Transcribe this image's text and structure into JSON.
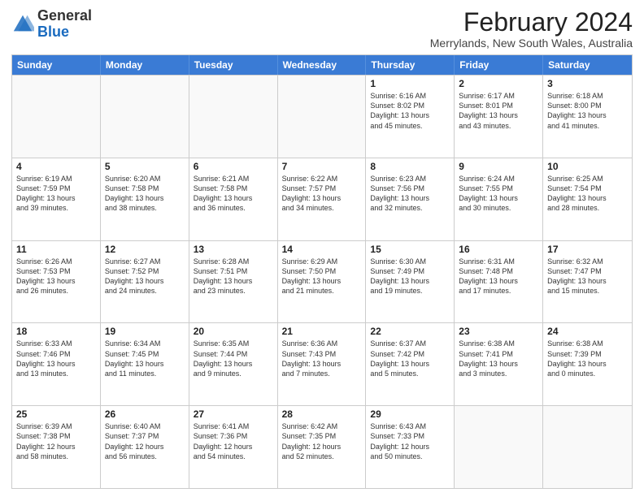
{
  "header": {
    "logo": {
      "general": "General",
      "blue": "Blue"
    },
    "title": "February 2024",
    "location": "Merrylands, New South Wales, Australia"
  },
  "calendar": {
    "days_of_week": [
      "Sunday",
      "Monday",
      "Tuesday",
      "Wednesday",
      "Thursday",
      "Friday",
      "Saturday"
    ],
    "weeks": [
      [
        {
          "day": "",
          "info": ""
        },
        {
          "day": "",
          "info": ""
        },
        {
          "day": "",
          "info": ""
        },
        {
          "day": "",
          "info": ""
        },
        {
          "day": "1",
          "info": "Sunrise: 6:16 AM\nSunset: 8:02 PM\nDaylight: 13 hours\nand 45 minutes."
        },
        {
          "day": "2",
          "info": "Sunrise: 6:17 AM\nSunset: 8:01 PM\nDaylight: 13 hours\nand 43 minutes."
        },
        {
          "day": "3",
          "info": "Sunrise: 6:18 AM\nSunset: 8:00 PM\nDaylight: 13 hours\nand 41 minutes."
        }
      ],
      [
        {
          "day": "4",
          "info": "Sunrise: 6:19 AM\nSunset: 7:59 PM\nDaylight: 13 hours\nand 39 minutes."
        },
        {
          "day": "5",
          "info": "Sunrise: 6:20 AM\nSunset: 7:58 PM\nDaylight: 13 hours\nand 38 minutes."
        },
        {
          "day": "6",
          "info": "Sunrise: 6:21 AM\nSunset: 7:58 PM\nDaylight: 13 hours\nand 36 minutes."
        },
        {
          "day": "7",
          "info": "Sunrise: 6:22 AM\nSunset: 7:57 PM\nDaylight: 13 hours\nand 34 minutes."
        },
        {
          "day": "8",
          "info": "Sunrise: 6:23 AM\nSunset: 7:56 PM\nDaylight: 13 hours\nand 32 minutes."
        },
        {
          "day": "9",
          "info": "Sunrise: 6:24 AM\nSunset: 7:55 PM\nDaylight: 13 hours\nand 30 minutes."
        },
        {
          "day": "10",
          "info": "Sunrise: 6:25 AM\nSunset: 7:54 PM\nDaylight: 13 hours\nand 28 minutes."
        }
      ],
      [
        {
          "day": "11",
          "info": "Sunrise: 6:26 AM\nSunset: 7:53 PM\nDaylight: 13 hours\nand 26 minutes."
        },
        {
          "day": "12",
          "info": "Sunrise: 6:27 AM\nSunset: 7:52 PM\nDaylight: 13 hours\nand 24 minutes."
        },
        {
          "day": "13",
          "info": "Sunrise: 6:28 AM\nSunset: 7:51 PM\nDaylight: 13 hours\nand 23 minutes."
        },
        {
          "day": "14",
          "info": "Sunrise: 6:29 AM\nSunset: 7:50 PM\nDaylight: 13 hours\nand 21 minutes."
        },
        {
          "day": "15",
          "info": "Sunrise: 6:30 AM\nSunset: 7:49 PM\nDaylight: 13 hours\nand 19 minutes."
        },
        {
          "day": "16",
          "info": "Sunrise: 6:31 AM\nSunset: 7:48 PM\nDaylight: 13 hours\nand 17 minutes."
        },
        {
          "day": "17",
          "info": "Sunrise: 6:32 AM\nSunset: 7:47 PM\nDaylight: 13 hours\nand 15 minutes."
        }
      ],
      [
        {
          "day": "18",
          "info": "Sunrise: 6:33 AM\nSunset: 7:46 PM\nDaylight: 13 hours\nand 13 minutes."
        },
        {
          "day": "19",
          "info": "Sunrise: 6:34 AM\nSunset: 7:45 PM\nDaylight: 13 hours\nand 11 minutes."
        },
        {
          "day": "20",
          "info": "Sunrise: 6:35 AM\nSunset: 7:44 PM\nDaylight: 13 hours\nand 9 minutes."
        },
        {
          "day": "21",
          "info": "Sunrise: 6:36 AM\nSunset: 7:43 PM\nDaylight: 13 hours\nand 7 minutes."
        },
        {
          "day": "22",
          "info": "Sunrise: 6:37 AM\nSunset: 7:42 PM\nDaylight: 13 hours\nand 5 minutes."
        },
        {
          "day": "23",
          "info": "Sunrise: 6:38 AM\nSunset: 7:41 PM\nDaylight: 13 hours\nand 3 minutes."
        },
        {
          "day": "24",
          "info": "Sunrise: 6:38 AM\nSunset: 7:39 PM\nDaylight: 13 hours\nand 0 minutes."
        }
      ],
      [
        {
          "day": "25",
          "info": "Sunrise: 6:39 AM\nSunset: 7:38 PM\nDaylight: 12 hours\nand 58 minutes."
        },
        {
          "day": "26",
          "info": "Sunrise: 6:40 AM\nSunset: 7:37 PM\nDaylight: 12 hours\nand 56 minutes."
        },
        {
          "day": "27",
          "info": "Sunrise: 6:41 AM\nSunset: 7:36 PM\nDaylight: 12 hours\nand 54 minutes."
        },
        {
          "day": "28",
          "info": "Sunrise: 6:42 AM\nSunset: 7:35 PM\nDaylight: 12 hours\nand 52 minutes."
        },
        {
          "day": "29",
          "info": "Sunrise: 6:43 AM\nSunset: 7:33 PM\nDaylight: 12 hours\nand 50 minutes."
        },
        {
          "day": "",
          "info": ""
        },
        {
          "day": "",
          "info": ""
        }
      ]
    ]
  }
}
